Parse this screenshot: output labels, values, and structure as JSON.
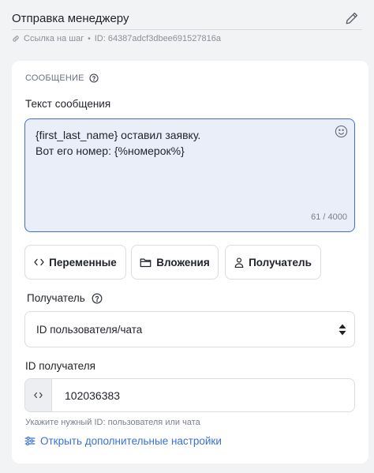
{
  "header": {
    "title": "Отправка менеджеру",
    "step_link": "Ссылка на шаг",
    "step_id": "ID: 64387adcf3dbee691527816a"
  },
  "message_section": {
    "label": "СООБЩЕНИЕ",
    "text_label": "Текст сообщения",
    "text_lines": [
      "{first_last_name} оставил заявку.",
      "Вот его номер: {%номерок%}"
    ],
    "counter": "61 / 4000"
  },
  "toolbar": {
    "variables": "Переменные",
    "attachments": "Вложения",
    "recipient": "Получатель"
  },
  "recipient": {
    "label": "Получатель",
    "selected": "ID пользователя/чата"
  },
  "recipient_id": {
    "label": "ID получателя",
    "value": "102036383",
    "hint": "Укажите нужный ID: пользователя или чата"
  },
  "advanced_link": "Открыть дополнительные настройки",
  "colors": {
    "accent": "#3b6fd6",
    "textarea_bg": "#e9eef9",
    "page_bg": "#f2f3f5"
  },
  "icons": [
    "pencil-icon",
    "link-icon",
    "help-icon",
    "emoji-icon",
    "code-icon",
    "folder-icon",
    "user-icon",
    "select-arrows-icon",
    "sliders-icon"
  ]
}
